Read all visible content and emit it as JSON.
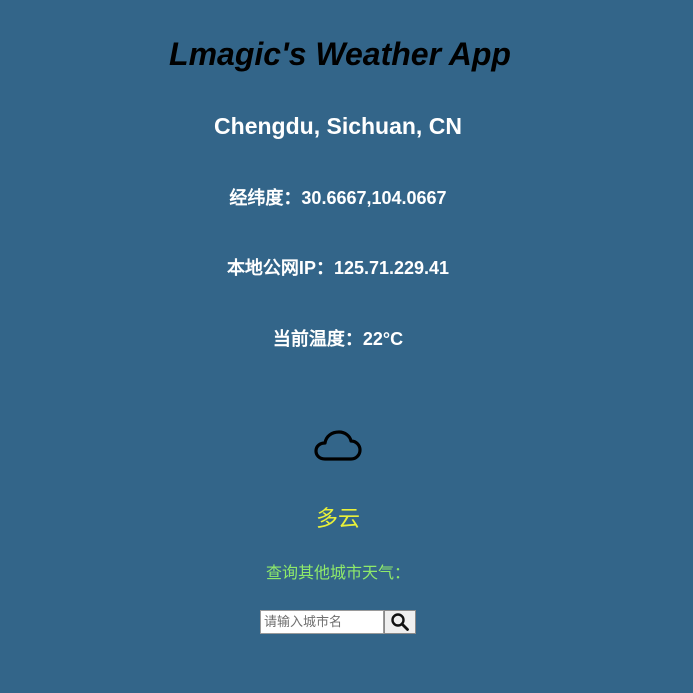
{
  "app": {
    "title": "Lmagic's Weather App"
  },
  "location": {
    "name": "Chengdu, Sichuan, CN",
    "coordinates": "经纬度：30.6667,104.0667",
    "public_ip": "本地公网IP：125.71.229.41",
    "temperature": "当前温度：22°C"
  },
  "weather": {
    "icon": "cloud-icon",
    "condition": "多云",
    "condition_color": "#e8f03a"
  },
  "search": {
    "prompt": "查询其他城市天气：",
    "placeholder": "请输入城市名",
    "button_icon": "search-icon"
  },
  "colors": {
    "background": "#336589",
    "title": "#000000",
    "text": "#ffffff",
    "prompt": "#8fea6a"
  }
}
